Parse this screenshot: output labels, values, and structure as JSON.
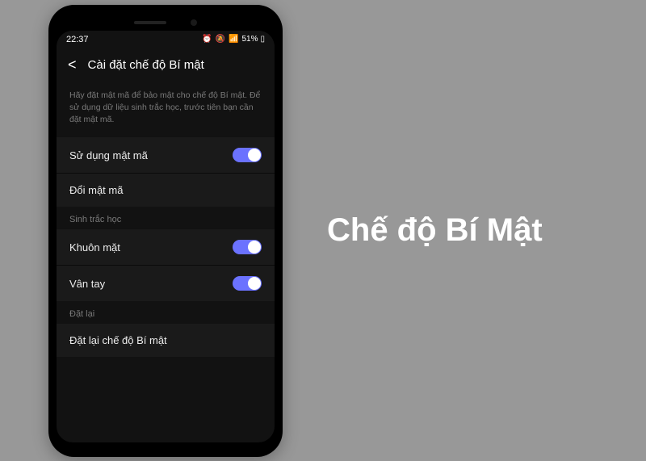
{
  "status_bar": {
    "time": "22:37",
    "battery_percent": "51%",
    "icons": "⏰ 🔕 📶 📶"
  },
  "header": {
    "title": "Cài đặt chế độ Bí mật"
  },
  "description": "Hãy đặt mật mã để bảo mật cho chế độ Bí mật. Để sử dụng dữ liệu sinh trắc học, trước tiên bạn cần đặt mật mã.",
  "sections": {
    "passcode": {
      "use_passcode_label": "Sử dụng mật mã",
      "use_passcode_on": true,
      "change_passcode_label": "Đổi mật mã"
    },
    "biometrics": {
      "header": "Sinh trắc học",
      "face_label": "Khuôn mặt",
      "face_on": true,
      "fingerprint_label": "Vân tay",
      "fingerprint_on": true
    },
    "reset": {
      "header": "Đặt lại",
      "reset_label": "Đặt lại chế độ Bí mật"
    }
  },
  "side_title": "Chế độ Bí Mật",
  "colors": {
    "toggle_on": "#6b72ff",
    "background": "#989898",
    "screen_bg": "#121212",
    "row_bg": "#1a1a1a"
  }
}
